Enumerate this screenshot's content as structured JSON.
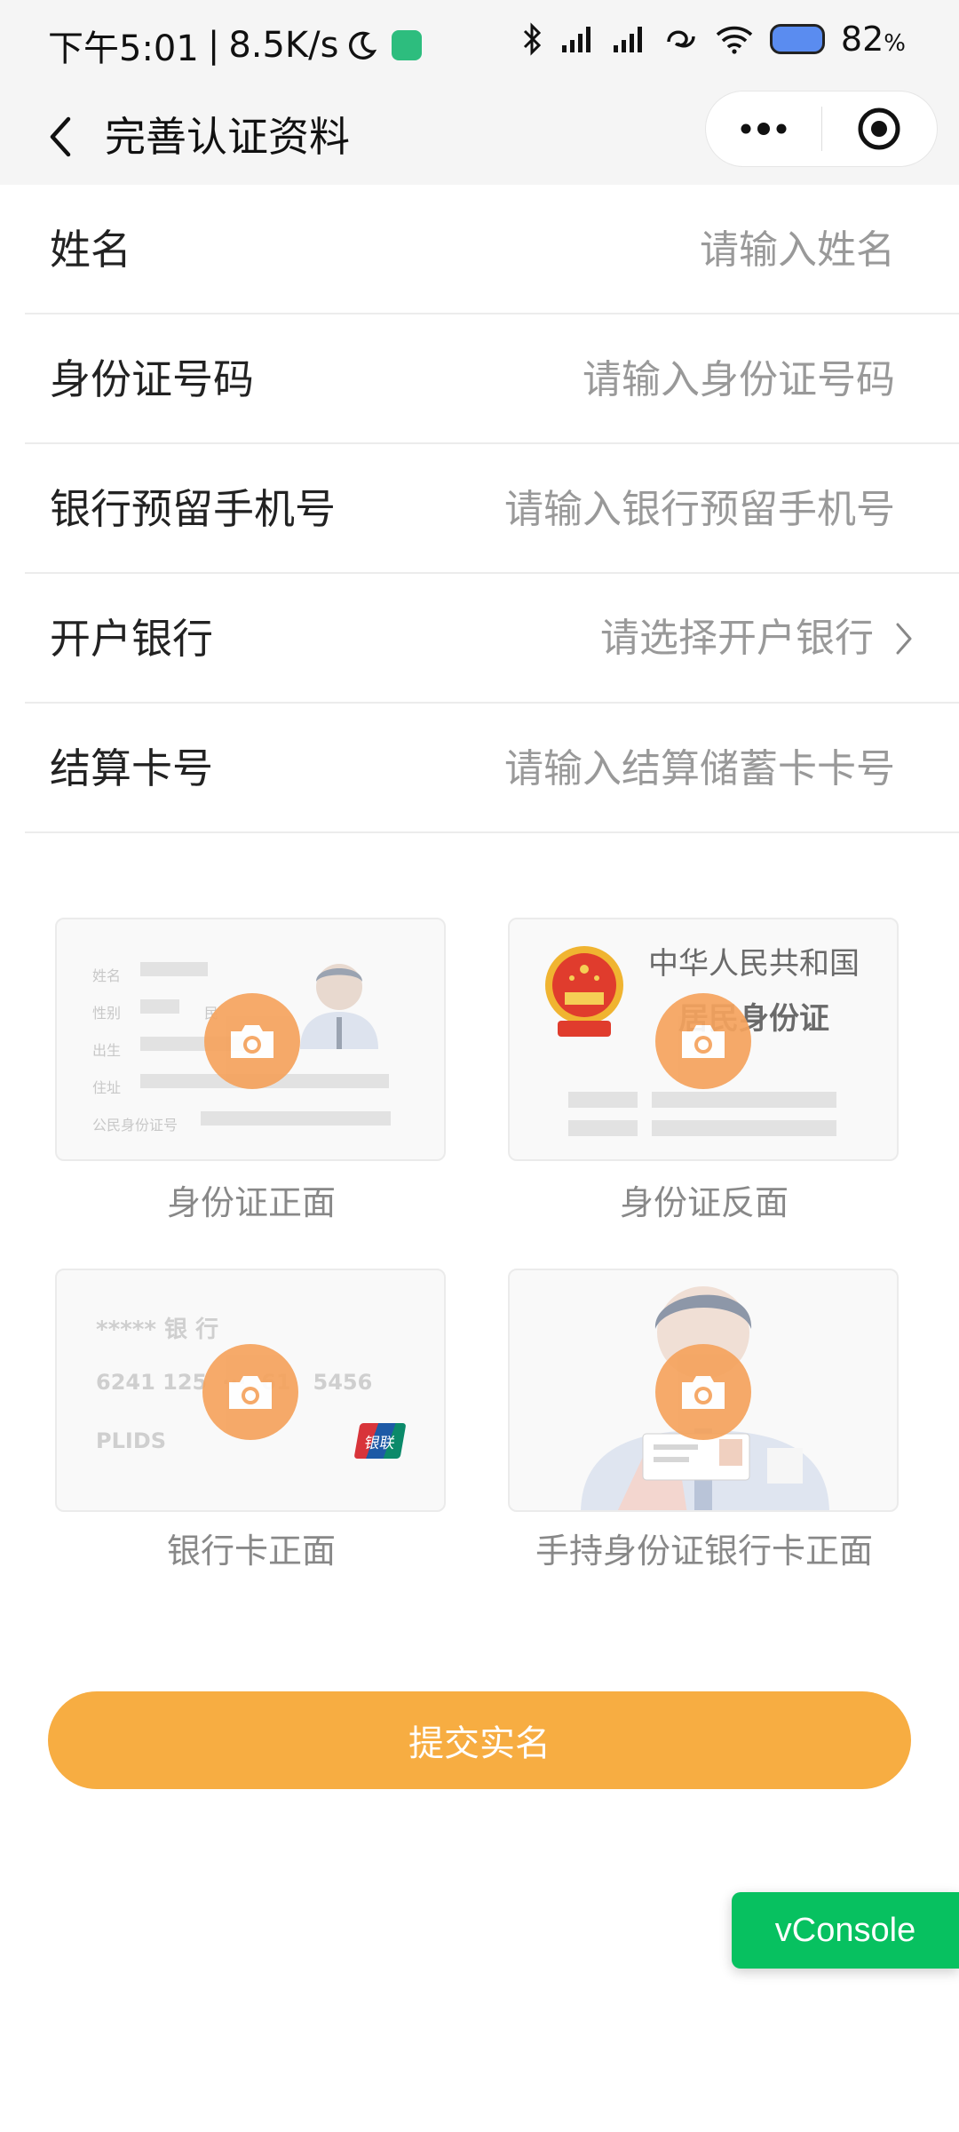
{
  "status_bar": {
    "time": "下午5:01",
    "speed": "8.5K/s",
    "battery": "82",
    "battery_unit": "%"
  },
  "nav": {
    "title": "完善认证资料"
  },
  "form": {
    "fields": [
      {
        "label": "姓名",
        "placeholder": "请输入姓名"
      },
      {
        "label": "身份证号码",
        "placeholder": "请输入身份证号码"
      },
      {
        "label": "银行预留手机号",
        "placeholder": "请输入银行预留手机号"
      },
      {
        "label": "开户银行",
        "placeholder": "请选择开户银行"
      },
      {
        "label": "结算卡号",
        "placeholder": "请输入结算储蓄卡卡号"
      }
    ]
  },
  "uploads": {
    "id_front": {
      "caption": "身份证正面",
      "labels": [
        "姓名",
        "性别",
        "民",
        "出生",
        "住址",
        "公民身份证号"
      ]
    },
    "id_back": {
      "caption": "身份证反面",
      "line1": "中华人民共和国",
      "line2": "居民身份证"
    },
    "bank_card": {
      "caption": "银行卡正面",
      "bank": "***** 银 行",
      "number": "6241 125  ···  61   5456",
      "name": "PLIDS",
      "logo": "银联"
    },
    "holding": {
      "caption": "手持身份证银行卡正面"
    }
  },
  "submit_label": "提交实名",
  "vconsole_label": "vConsole",
  "colors": {
    "accent": "#f7ad42",
    "camera": "#f5a35d",
    "vconsole": "#07c160"
  }
}
